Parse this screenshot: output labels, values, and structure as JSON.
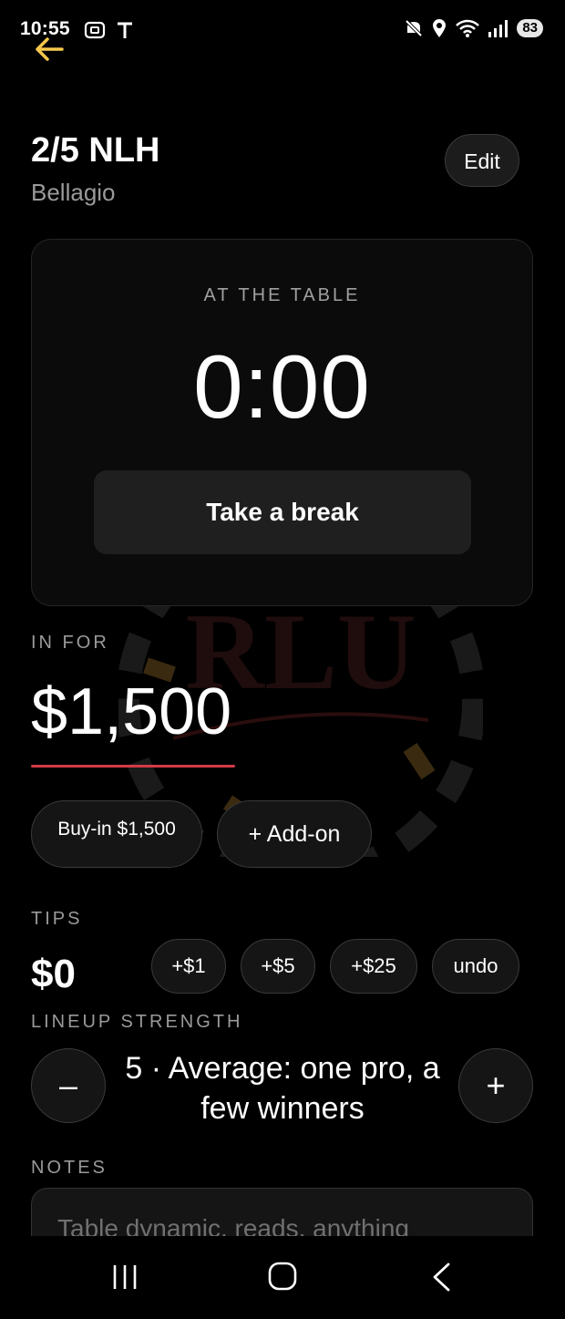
{
  "status_bar": {
    "time": "10:55",
    "left_icons": [
      "screenshot-icon",
      "t-icon"
    ],
    "right_icons": [
      "mute-icon",
      "location-icon",
      "wifi-icon",
      "signal-icon"
    ],
    "battery": "83"
  },
  "header": {
    "title": "2/5 NLH",
    "subtitle": "Bellagio",
    "edit_label": "Edit",
    "accent_color": "#f5c84c"
  },
  "table_card": {
    "label": "AT THE TABLE",
    "timer": "0:00",
    "break_button": "Take a break"
  },
  "in_for": {
    "label": "IN FOR",
    "value": "$1,500",
    "underline_color": "#d23a48",
    "buyin_button": "Buy-in $1,500",
    "addon_button": "+ Add-on"
  },
  "watermark": {
    "text": "RLU"
  },
  "tips": {
    "label": "TIPS",
    "value": "$0",
    "buttons": [
      "+$1",
      "+$5",
      "+$25",
      "undo"
    ]
  },
  "lineup": {
    "label": "LINEUP STRENGTH",
    "minus": "–",
    "plus": "+",
    "line1": "5 · Average: one pro, a",
    "line2": "few winners"
  },
  "notes": {
    "label": "NOTES",
    "placeholder": "Table dynamic, reads, anything"
  },
  "nav_bar": {
    "items": [
      "recents-icon",
      "home-icon",
      "back-icon"
    ]
  }
}
